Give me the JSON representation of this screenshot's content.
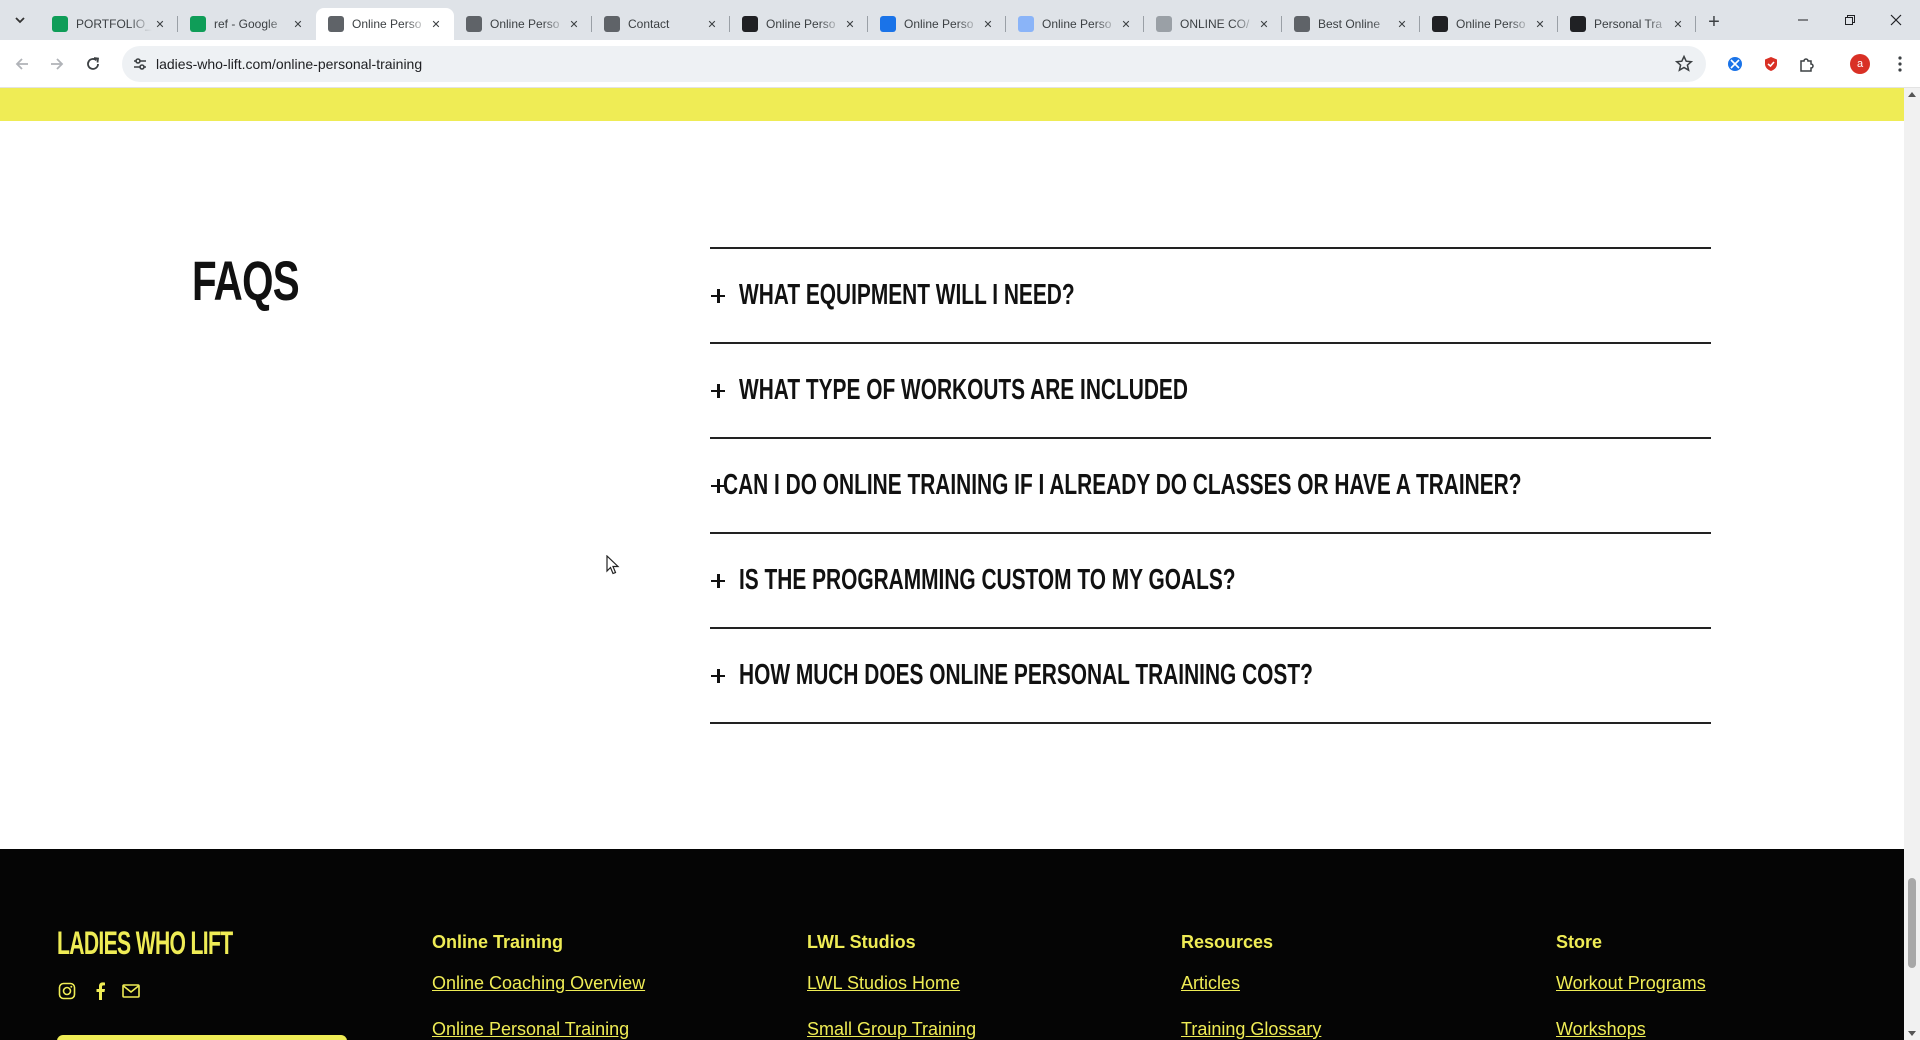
{
  "browser": {
    "tabs": [
      {
        "title": "PORTFOLIO_",
        "icon": "google-sheets-icon",
        "color": "#0f9d58",
        "active": false
      },
      {
        "title": "ref - Google",
        "icon": "google-sheets-icon",
        "color": "#0f9d58",
        "active": false
      },
      {
        "title": "Online Perso",
        "icon": "cube-icon",
        "color": "#5f6368",
        "active": true
      },
      {
        "title": "Online Perso",
        "icon": "cube-icon",
        "color": "#5f6368",
        "active": false
      },
      {
        "title": "Contact",
        "icon": "cube-icon",
        "color": "#5f6368",
        "active": false
      },
      {
        "title": "Online Perso",
        "icon": "k-logo-icon",
        "color": "#202124",
        "active": false
      },
      {
        "title": "Online Perso",
        "icon": "chart-logo-icon",
        "color": "#1a73e8",
        "active": false
      },
      {
        "title": "Online Perso",
        "icon": "globe-icon",
        "color": "#8ab4f8",
        "active": false
      },
      {
        "title": "ONLINE CO/",
        "icon": "runner-icon",
        "color": "#9aa0a6",
        "active": false
      },
      {
        "title": "Best Online",
        "icon": "globe-icon",
        "color": "#5f6368",
        "active": false
      },
      {
        "title": "Online Perso",
        "icon": "peak-logo-icon",
        "color": "#202124",
        "active": false
      },
      {
        "title": "Personal Tra",
        "icon": "fs-logo-icon",
        "color": "#202124",
        "active": false
      }
    ],
    "url": "ladies-who-lift.com/online-personal-training",
    "profile_initial": "a"
  },
  "faq": {
    "heading": "FAQS",
    "items": [
      "WHAT EQUIPMENT WILL I NEED?",
      "WHAT TYPE OF WORKOUTS ARE INCLUDED",
      "CAN I DO ONLINE TRAINING IF I ALREADY DO CLASSES OR HAVE A TRAINER?",
      "IS THE PROGRAMMING CUSTOM TO MY GOALS?",
      "HOW MUCH DOES ONLINE PERSONAL TRAINING COST?"
    ]
  },
  "footer": {
    "logo": "LADIES WHO LIFT",
    "columns": [
      {
        "heading": "Online Training",
        "links": [
          "Online Coaching Overview",
          "Online Personal Training"
        ]
      },
      {
        "heading": "LWL Studios",
        "links": [
          "LWL Studios Home",
          "Small Group Training"
        ]
      },
      {
        "heading": "Resources",
        "links": [
          "Articles",
          "Training Glossary"
        ]
      },
      {
        "heading": "Store",
        "links": [
          "Workout Programs",
          "Workshops"
        ]
      }
    ]
  },
  "colors": {
    "brand_yellow": "#efec55",
    "footer_bg": "#050505",
    "text": "#111111"
  },
  "scroll_position_fraction": 0.88
}
